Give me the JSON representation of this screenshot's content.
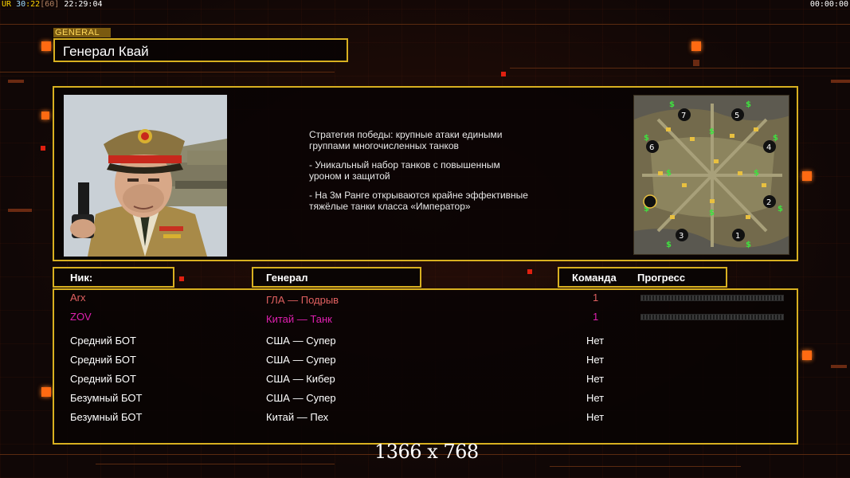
{
  "hud": {
    "ur_label": "UR",
    "fps": "30",
    "fps_sep": ":",
    "fps2": "22",
    "frame": "[60]",
    "clock": "22:29:04",
    "timer": "00:00:00"
  },
  "header": {
    "section_tag": "GENERAL",
    "general_name": "Генерал Квай"
  },
  "description": [
    "Стратегия победы: крупные атаки едиными\n группами многочисленных танков",
    "- Уникальный набор танков с повышенным\n уроном и защитой",
    "- На 3м Ранге открываются крайне эффективные\n тяжёлые танки класса «Император»"
  ],
  "table": {
    "col_nick": "Ник:",
    "col_general": "Генерал",
    "col_team": "Команда",
    "col_progress": "Прогресс"
  },
  "players": [
    {
      "nick": "Arx",
      "general": "ГЛА — Подрыв",
      "team": "1",
      "color": "#e06060",
      "progress": 0
    },
    {
      "nick": "ZOV",
      "general": "Китай — Танк",
      "team": "1",
      "color": "#e020b0",
      "progress": 0
    },
    {
      "nick": "Средний БОТ",
      "general": "США — Супер",
      "team": "Нет",
      "color": "#ffffff"
    },
    {
      "nick": "Средний БОТ",
      "general": "США — Супер",
      "team": "Нет",
      "color": "#ffffff"
    },
    {
      "nick": "Средний БОТ",
      "general": "США — Кибер",
      "team": "Нет",
      "color": "#ffffff"
    },
    {
      "nick": "Безумный БОТ",
      "general": "США — Супер",
      "team": "Нет",
      "color": "#ffffff"
    },
    {
      "nick": "Безумный БОТ",
      "general": "Китай — Пех",
      "team": "Нет",
      "color": "#ffffff"
    }
  ],
  "minimap": {
    "start_positions": [
      "7",
      "5",
      "6",
      "4",
      "2",
      "3",
      "1"
    ]
  },
  "resolution": "1366 x 768",
  "colors": {
    "frame": "#d8b020",
    "accent": "#ff6a12",
    "background": "#100706"
  }
}
